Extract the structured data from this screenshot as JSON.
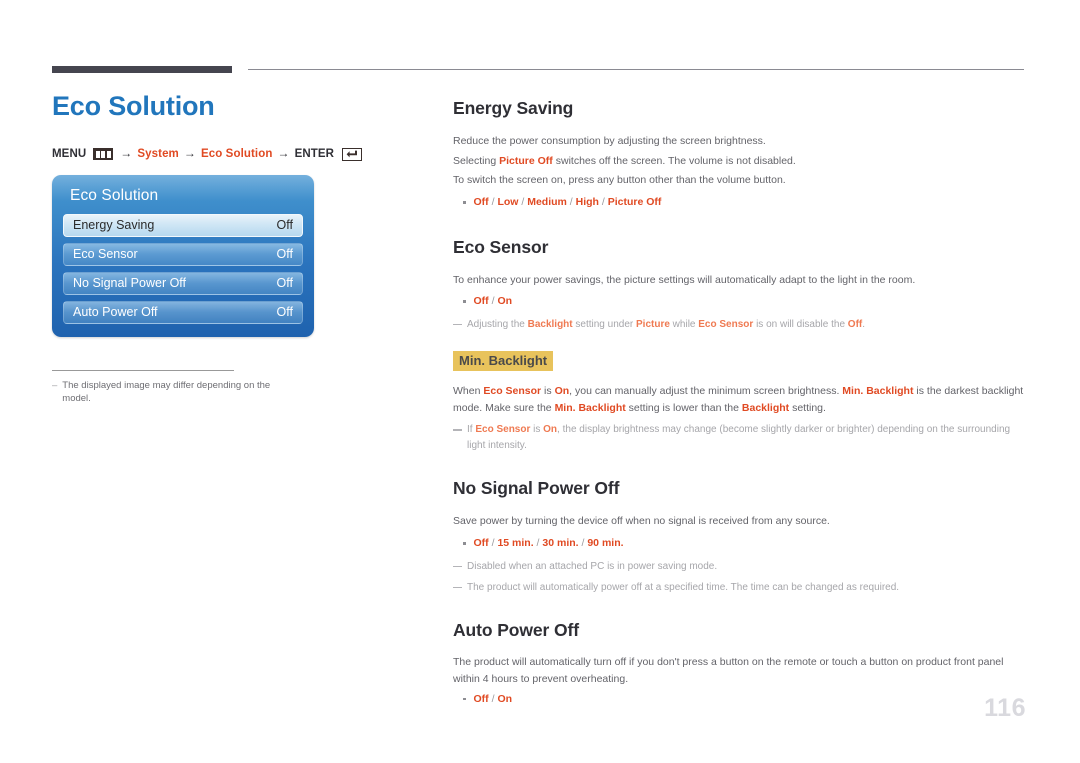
{
  "page": {
    "number": "116"
  },
  "left": {
    "title": "Eco Solution",
    "breadcrumb": {
      "menu_label": "MENU",
      "menu_icon": "menu-bars-icon",
      "arrow": "→",
      "step_system": "System",
      "step_eco_solution": "Eco Solution",
      "enter_label": "ENTER",
      "enter_icon": "enter-key-icon"
    },
    "osd": {
      "header": "Eco Solution",
      "rows": [
        {
          "label": "Energy Saving",
          "value": "Off",
          "selected": true
        },
        {
          "label": "Eco Sensor",
          "value": "Off",
          "selected": false
        },
        {
          "label": "No Signal Power Off",
          "value": "Off",
          "selected": false
        },
        {
          "label": "Auto Power Off",
          "value": "Off",
          "selected": false
        }
      ]
    },
    "note": {
      "dash": "–",
      "text": "The displayed image may differ depending on the model."
    }
  },
  "sections": {
    "energy_saving": {
      "title": "Energy Saving",
      "line1": "Reduce the power consumption by adjusting the screen brightness.",
      "line2_a": "Selecting ",
      "line2_em": "Picture Off",
      "line2_b": " switches off the screen. The volume is not disabled.",
      "line3": "To switch the screen on, press any button other than the volume button.",
      "options": [
        "Off",
        "Low",
        "Medium",
        "High",
        "Picture Off"
      ]
    },
    "eco_sensor": {
      "title": "Eco Sensor",
      "line1": "To enhance your power savings, the picture settings will automatically adapt to the light in the room.",
      "options": [
        "Off",
        "On"
      ],
      "note_a": "Adjusting the ",
      "note_em1": "Backlight",
      "note_b": " setting under ",
      "note_em2": "Picture",
      "note_c": " while ",
      "note_em3": "Eco Sensor",
      "note_d": " is on will disable the ",
      "note_em4": "Off",
      "note_e": "."
    },
    "min_backlight": {
      "heading": "Min. Backlight",
      "p_a": "When ",
      "p_em1": "Eco Sensor",
      "p_b": " is ",
      "p_em2": "On",
      "p_c": ", you can manually adjust the minimum screen brightness. ",
      "p_em3": "Min. Backlight",
      "p_d": " is the darkest backlight mode. Make sure the ",
      "p_em4": "Min. Backlight",
      "p_e": " setting is lower than the ",
      "p_em5": "Backlight",
      "p_f": " setting.",
      "note_a": "If ",
      "note_em1": "Eco Sensor",
      "note_b": " is ",
      "note_em2": "On",
      "note_c": ", the display brightness may change (become slightly darker or brighter) depending on the surrounding light intensity."
    },
    "no_signal_power_off": {
      "title": "No Signal Power Off",
      "line1": "Save power by turning the device off when no signal is received from any source.",
      "options": [
        "Off",
        "15 min.",
        "30 min.",
        "90 min."
      ],
      "note1": "Disabled when an attached PC is in power saving mode.",
      "note2": "The product will automatically power off at a specified time. The time can be changed as required."
    },
    "auto_power_off": {
      "title": "Auto Power Off",
      "line1": "The product will automatically turn off if you don't press a button on the remote or touch a button on product front panel within 4 hours to prevent overheating.",
      "options": [
        "Off",
        "On"
      ]
    }
  }
}
